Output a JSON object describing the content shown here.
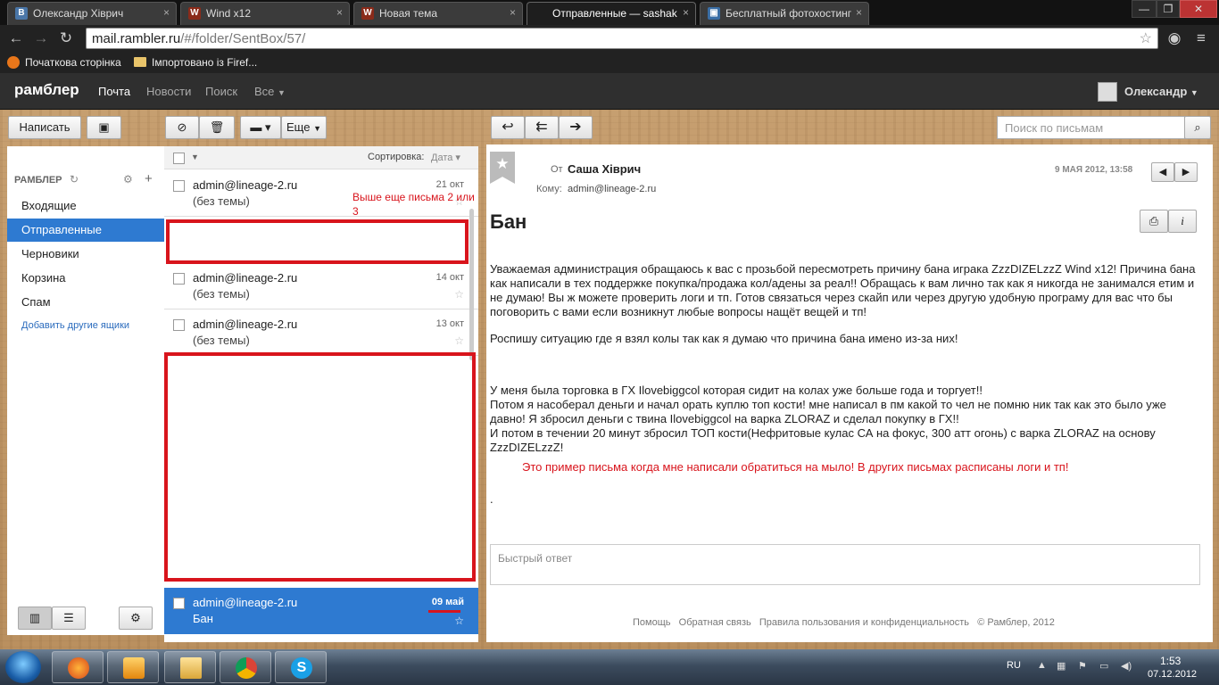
{
  "browser": {
    "tabs": [
      {
        "title": "Олександр Хіврич",
        "icon": "vk-icon",
        "active": false
      },
      {
        "title": "Wind x12",
        "icon": "site-icon",
        "active": false
      },
      {
        "title": "Новая тема",
        "icon": "site-icon",
        "active": false
      },
      {
        "title": "Отправленные — sashak",
        "icon": "none",
        "active": true
      },
      {
        "title": "Бесплатный фотохостинг",
        "icon": "photo-icon",
        "active": false
      }
    ],
    "url_domain": "mail.rambler.ru",
    "url_path": "/#/folder/SentBox/57/",
    "bookmarks": [
      "Початкова сторінка",
      "Імпортовано із Firef..."
    ]
  },
  "rambler": {
    "logo": "рамблер",
    "nav": [
      "Почта",
      "Новости",
      "Поиск",
      "Все"
    ],
    "user": "Олександр"
  },
  "toolbar": {
    "compose": "Написать",
    "more": "Еще",
    "search_placeholder": "Поиск по письмам"
  },
  "sidebar": {
    "header": "РАМБЛЕР",
    "folders": [
      {
        "label": "Входящие",
        "selected": false
      },
      {
        "label": "Отправленные",
        "selected": true
      },
      {
        "label": "Черновики",
        "selected": false
      },
      {
        "label": "Корзина",
        "selected": false
      },
      {
        "label": "Спам",
        "selected": false
      }
    ],
    "add_link": "Добавить другие ящики"
  },
  "list": {
    "sort_label": "Сортировка:",
    "sort_value": "Дата",
    "rows": [
      {
        "from": "admin@lineage-2.ru",
        "subject": "(без темы)",
        "date": "21 окт"
      },
      {
        "from": "admin@lineage-2.ru",
        "subject": "(без темы)",
        "date": "14 окт"
      },
      {
        "from": "admin@lineage-2.ru",
        "subject": "(без темы)",
        "date": "13 окт"
      },
      {
        "from": "admin@lineage-2.ru",
        "subject": "Бан",
        "date": "09 май"
      }
    ],
    "annotation": "Выше еще письма 2 или 3"
  },
  "message": {
    "from_label": "От",
    "from_name": "Саша Хіврич",
    "to_label": "Кому:",
    "to_address": "admin@lineage-2.ru",
    "date": "9 МАЯ 2012, 13:58",
    "subject": "Бан",
    "paragraphs": [
      "Уважаемая администрация обращаюсь к вас с прозьбой пересмотреть причину бана играка ZzzDIZELzzZ Wind x12! Причина бана как написали в тех поддержке покупка/продажа кол/адены за реал!! Обращась к вам лично так как я никогда не занимался етим и не думаю! Вы ж можете проверить логи и тп. Готов связаться через скайп или через другую удобную програму для вас что бы поговорить с вами если возникнут любые вопросы нащёт вещей и тп!",
      "Роспишу  ситуацию где я взял колы так как я думаю что причина бана имено из-за них!",
      "У меня была торговка в ГХ Ilovebiggcol которая сидит на колах уже больше года и торгует!!",
      "Потом я насоберал деньги и начал орать куплю топ кости! мне написал в пм какой то чел не помню ник так как это было уже давно! Я збросил деньги с твина Ilovebiggcol на варка ZLORAZ и сделал покупку в ГХ!!",
      "И потом в течении 20 минут збросил ТОП кости(Нефритовые кулас СА на фокус, 300 атт огонь) с варка ZLORAZ на основу ZzzDIZELzzZ!"
    ],
    "annotation": "Это пример письма когда мне написали обратиться на мыло!  В других письмах расписаны логи и тп!",
    "dot": ".",
    "quick_reply_placeholder": "Быстрый ответ"
  },
  "footer": {
    "links": [
      "Помощь",
      "Обратная связь",
      "Правила пользования и конфиденциальность",
      "© Рамблер, 2012"
    ]
  },
  "taskbar": {
    "lang": "RU",
    "time": "1:53",
    "date": "07.12.2012"
  },
  "colors": {
    "accent": "#2e7ad1",
    "annotation_red": "#d8141c"
  }
}
